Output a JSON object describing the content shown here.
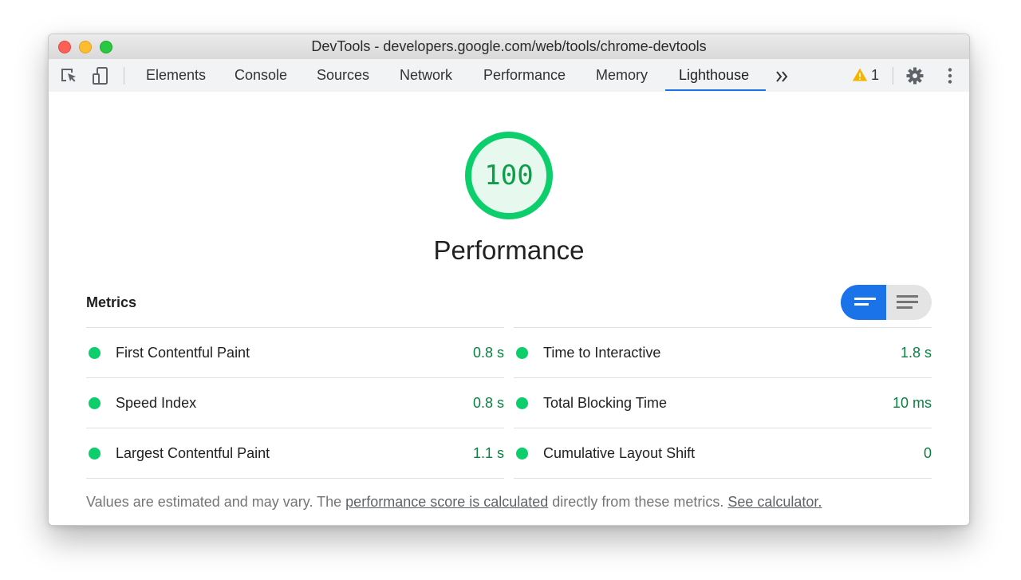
{
  "window": {
    "title": "DevTools - developers.google.com/web/tools/chrome-devtools"
  },
  "toolbar": {
    "tabs": [
      {
        "label": "Elements"
      },
      {
        "label": "Console"
      },
      {
        "label": "Sources"
      },
      {
        "label": "Network"
      },
      {
        "label": "Performance"
      },
      {
        "label": "Memory"
      },
      {
        "label": "Lighthouse",
        "active": true
      }
    ],
    "more_tabs_icon": "double-chevron-right-icon",
    "warning_count": "1"
  },
  "report": {
    "score": "100",
    "category_title": "Performance",
    "metrics_heading": "Metrics",
    "metrics_left": [
      {
        "title": "First Contentful Paint",
        "value": "0.8 s"
      },
      {
        "title": "Speed Index",
        "value": "0.8 s"
      },
      {
        "title": "Largest Contentful Paint",
        "value": "1.1 s"
      }
    ],
    "metrics_right": [
      {
        "title": "Time to Interactive",
        "value": "1.8 s"
      },
      {
        "title": "Total Blocking Time",
        "value": "10 ms"
      },
      {
        "title": "Cumulative Layout Shift",
        "value": "0"
      }
    ],
    "footnote": {
      "prefix": "Values are estimated and may vary. The ",
      "link1": "performance score is calculated",
      "middle": " directly from these metrics. ",
      "link2": "See calculator."
    }
  },
  "colors": {
    "pass_green": "#0cce6b",
    "pass_text": "#0b8043",
    "accent_blue": "#1a73e8",
    "warning_yellow": "#f4b400"
  }
}
